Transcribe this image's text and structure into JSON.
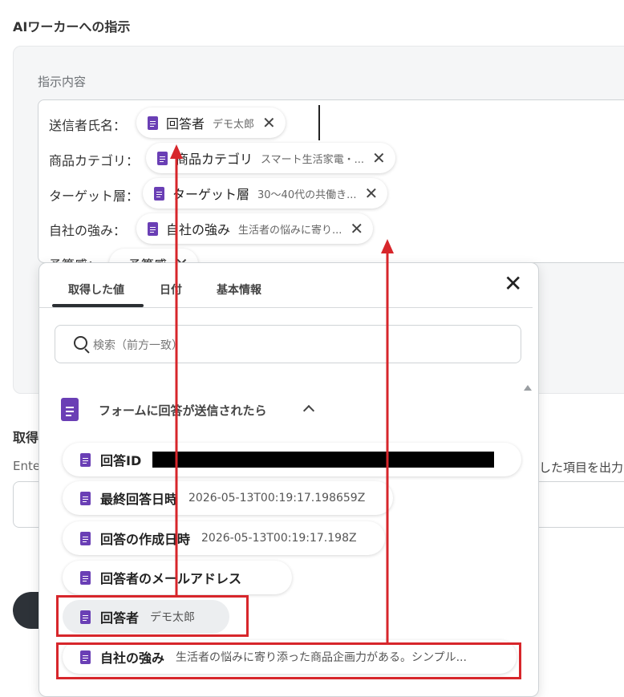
{
  "section_title": "AIワーカーへの指示",
  "panel_label": "指示内容",
  "editor_lines": [
    {
      "label": "送信者氏名：",
      "chip_label": "回答者",
      "chip_value": "デモ太郎"
    },
    {
      "label": "商品カテゴリ：",
      "chip_label": "商品カテゴリ",
      "chip_value": "スマート生活家電・..."
    },
    {
      "label": "ターゲット層：",
      "chip_label": "ターゲット層",
      "chip_value": "30〜40代の共働き..."
    },
    {
      "label": "自社の強み：",
      "chip_label": "自社の強み",
      "chip_value": "生活者の悩みに寄り..."
    },
    {
      "label": "予算感：",
      "chip_label": "予算感"
    }
  ],
  "background": {
    "label": "取得",
    "sub": "Ente",
    "sub_right": "した項目を出力"
  },
  "dropdown": {
    "tabs": [
      "取得した値",
      "日付",
      "基本情報"
    ],
    "active_tab": 0,
    "search_placeholder": "検索（前方一致）",
    "group_label": "フォームに回答が送信されたら",
    "items": [
      {
        "label": "回答ID",
        "value": "",
        "redacted": true
      },
      {
        "label": "最終回答日時",
        "value": "2026-05-13T00:19:17.198659Z"
      },
      {
        "label": "回答の作成日時",
        "value": "2026-05-13T00:19:17.198Z"
      },
      {
        "label": "回答者のメールアドレス",
        "value": ""
      },
      {
        "label": "回答者",
        "value": "デモ太郎"
      },
      {
        "label": "自社の強み",
        "value": "生活者の悩みに寄り添った商品企画力がある。シンプル..."
      }
    ]
  },
  "colors": {
    "accent_purple": "#6a3fb5",
    "annotation_red": "#d7262b"
  }
}
